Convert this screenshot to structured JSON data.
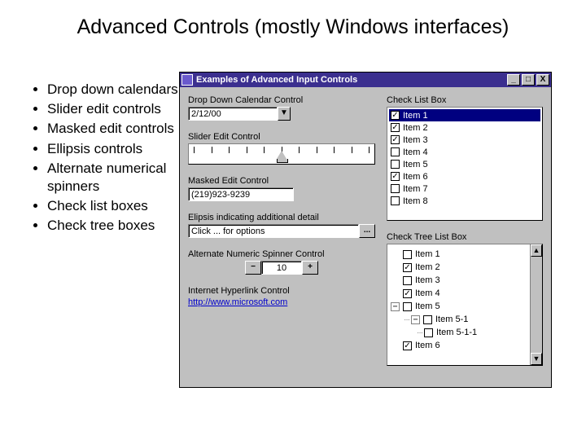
{
  "title": "Advanced Controls (mostly Windows interfaces)",
  "bullets": [
    "Drop down calendars",
    "Slider edit controls",
    "Masked edit controls",
    "Ellipsis controls",
    "Alternate numerical spinners",
    "Check list boxes",
    "Check tree boxes"
  ],
  "window": {
    "title": "Examples of Advanced Input Controls",
    "btn_min": "_",
    "btn_max": "□",
    "btn_close": "X"
  },
  "left": {
    "calendar_label": "Drop Down Calendar Control",
    "calendar_value": "2/12/00",
    "slider_label": "Slider Edit Control",
    "masked_label": "Masked Edit Control",
    "masked_value": "(219)923-9239",
    "ellipsis_label": "Elipsis indicating additional detail",
    "ellipsis_value": "Click ... for options",
    "ellipsis_btn": "...",
    "spinner_label": "Alternate Numeric Spinner Control",
    "spinner_minus": "−",
    "spinner_value": "10",
    "spinner_plus": "+",
    "hyper_label": "Internet Hyperlink Control",
    "hyper_url": "http://www.microsoft.com"
  },
  "checklist": {
    "label": "Check List Box",
    "items": [
      {
        "label": "Item 1",
        "checked": true,
        "selected": true
      },
      {
        "label": "Item 2",
        "checked": true,
        "selected": false
      },
      {
        "label": "Item 3",
        "checked": true,
        "selected": false
      },
      {
        "label": "Item 4",
        "checked": false,
        "selected": false
      },
      {
        "label": "Item 5",
        "checked": false,
        "selected": false
      },
      {
        "label": "Item 6",
        "checked": true,
        "selected": false
      },
      {
        "label": "Item 7",
        "checked": false,
        "selected": false
      },
      {
        "label": "Item 8",
        "checked": false,
        "selected": false
      }
    ]
  },
  "checktree": {
    "label": "Check Tree List Box",
    "nodes": [
      {
        "label": "Item 1",
        "checked": false,
        "expander": "",
        "indent": 0
      },
      {
        "label": "Item 2",
        "checked": true,
        "expander": "",
        "indent": 0
      },
      {
        "label": "Item 3",
        "checked": false,
        "expander": "",
        "indent": 0
      },
      {
        "label": "Item 4",
        "checked": true,
        "expander": "",
        "indent": 0
      },
      {
        "label": "Item 5",
        "checked": false,
        "expander": "−",
        "indent": 0
      },
      {
        "label": "Item 5-1",
        "checked": false,
        "expander": "−",
        "indent": 1
      },
      {
        "label": "Item 5-1-1",
        "checked": false,
        "expander": "",
        "indent": 2
      },
      {
        "label": "Item 6",
        "checked": true,
        "expander": "",
        "indent": 0
      }
    ]
  }
}
